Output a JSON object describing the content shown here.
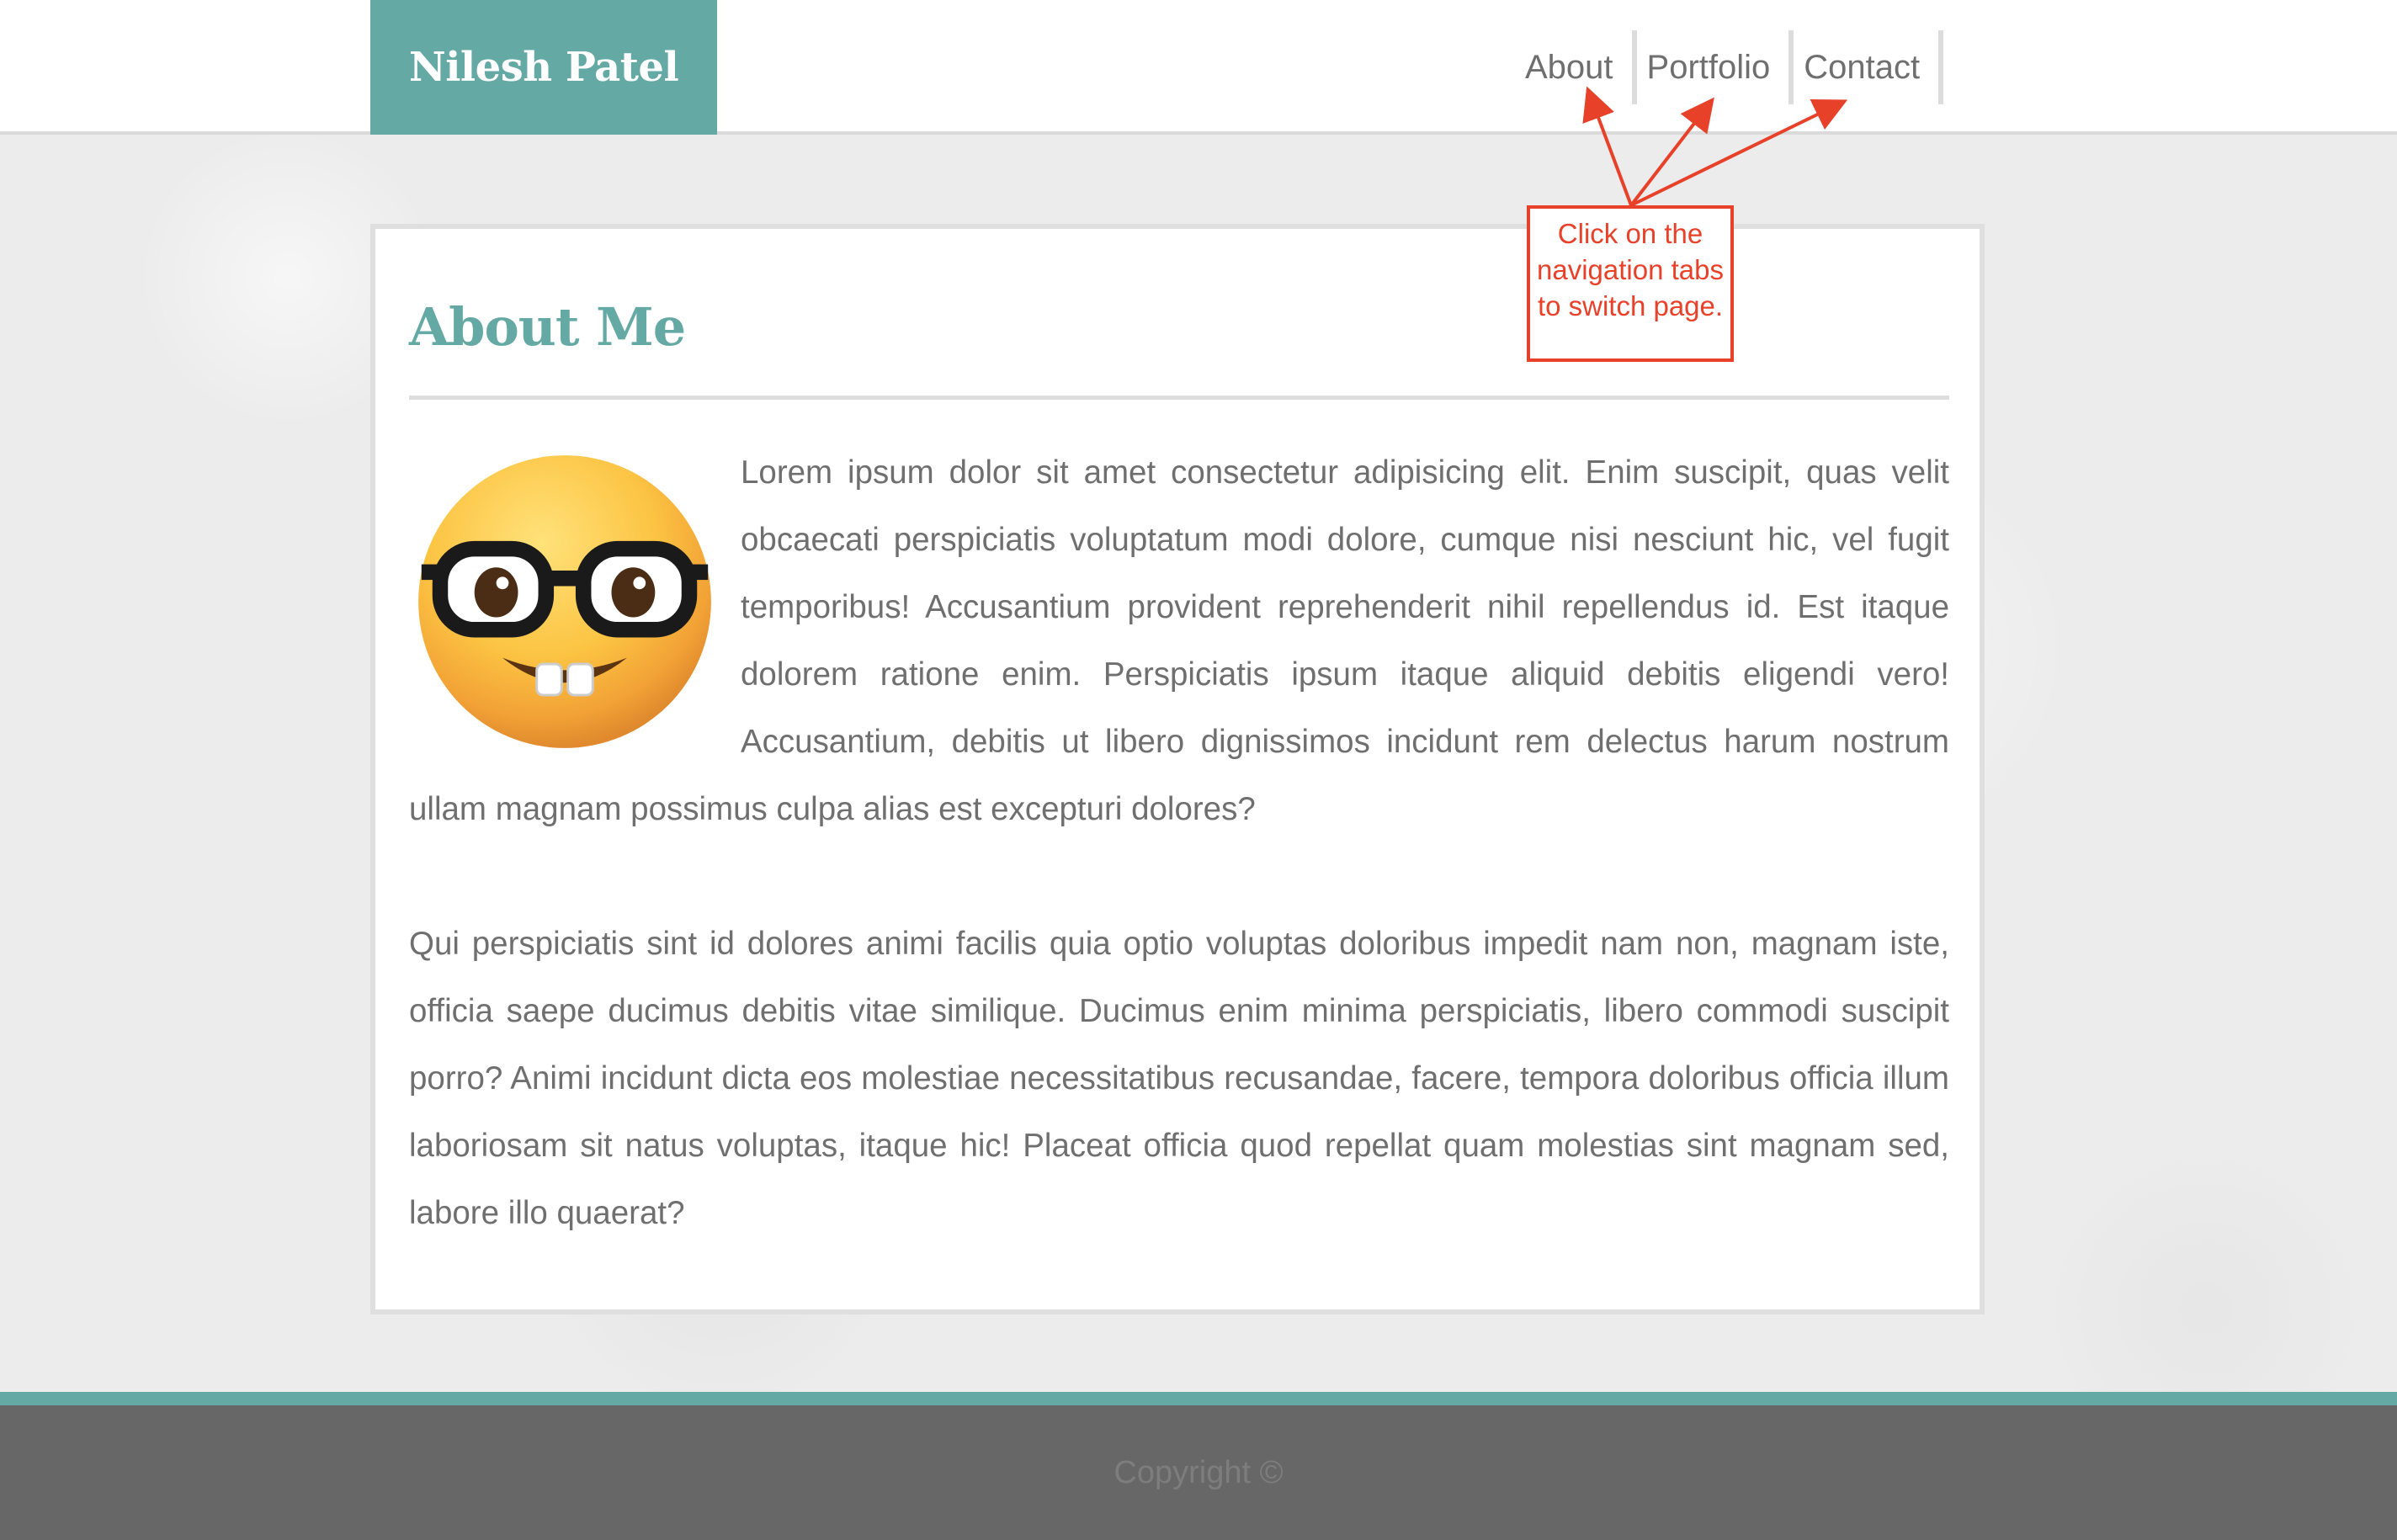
{
  "header": {
    "brand": "Nilesh Patel",
    "nav": [
      {
        "label": "About"
      },
      {
        "label": "Portfolio"
      },
      {
        "label": "Contact"
      }
    ]
  },
  "annotation": {
    "text": "Click on the navigation tabs to switch page."
  },
  "main": {
    "title": "About Me",
    "avatar_icon": "nerd-face-emoji",
    "paragraphs": [
      "Lorem ipsum dolor sit amet consectetur adipisicing elit. Enim suscipit, quas velit obcaecati perspiciatis voluptatum modi dolore, cumque nisi nesciunt hic, vel fugit temporibus! Accusantium provident reprehenderit nihil repellendus id. Est itaque dolorem ratione enim. Perspiciatis ipsum itaque aliquid debitis eligendi vero! Accusantium, debitis ut libero dignissimos incidunt rem delectus harum nostrum ullam magnam possimus culpa alias est excepturi dolores?",
      "Qui perspiciatis sint id dolores animi facilis quia optio voluptas doloribus impedit nam non, magnam iste, officia saepe ducimus debitis vitae similique. Ducimus enim minima perspiciatis, libero commodi suscipit porro? Animi incidunt dicta eos molestiae necessitatibus recusandae, facere, tempora doloribus officia illum laboriosam sit natus voluptas, itaque hic! Placeat officia quod repellat quam molestias sint magnam sed, labore illo quaerat?"
    ]
  },
  "footer": {
    "copyright": "Copyright ©"
  },
  "colors": {
    "accent": "#64a9a4",
    "annotation": "#e8412a",
    "footer_bg": "#676767",
    "text": "#6f6f6f"
  }
}
